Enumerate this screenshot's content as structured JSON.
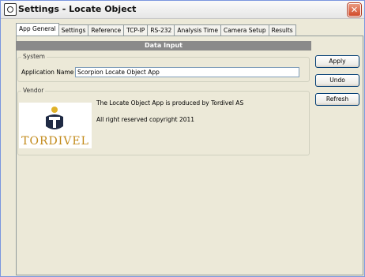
{
  "window": {
    "title": "Settings - Locate Object"
  },
  "tabs": [
    {
      "label": "App General"
    },
    {
      "label": "Settings"
    },
    {
      "label": "Reference"
    },
    {
      "label": "TCP-IP"
    },
    {
      "label": "RS-232"
    },
    {
      "label": "Analysis Time"
    },
    {
      "label": "Camera Setup"
    },
    {
      "label": "Results"
    }
  ],
  "panel": {
    "header": "Data Input",
    "system": {
      "legend": "System",
      "app_name_label": "Application Name",
      "app_name_value": "Scorpion Locate Object App"
    },
    "vendor": {
      "legend": "Vendor",
      "line1": "The Locate Object App is produced by Tordivel AS",
      "line2": "All right reserved copyright 2011",
      "logo_text": "TORDIVEL"
    }
  },
  "buttons": {
    "apply": "Apply",
    "undo": "Undo",
    "refresh": "Refresh"
  },
  "colors": {
    "brand": "#c28a1a",
    "header_bg": "#8a8a8a",
    "close": "#d24a2a"
  }
}
